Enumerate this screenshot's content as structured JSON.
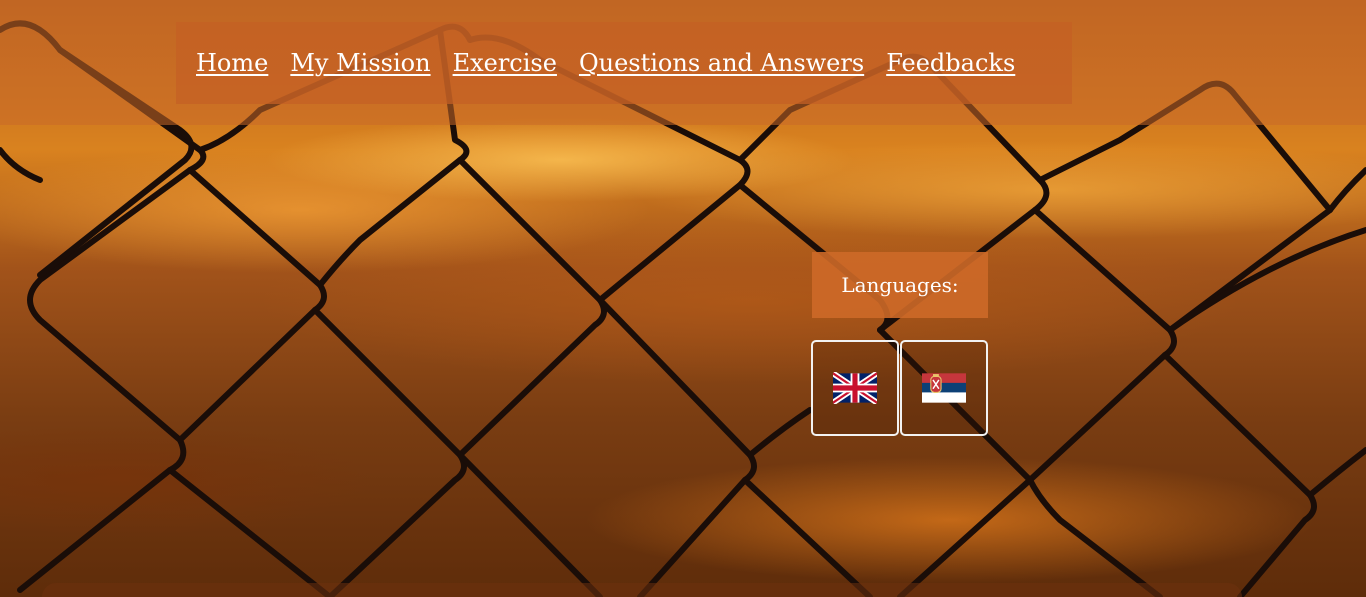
{
  "nav": {
    "items": [
      {
        "label": "Home"
      },
      {
        "label": "My Mission"
      },
      {
        "label": "Exercise"
      },
      {
        "label": "Questions and Answers"
      },
      {
        "label": "Feedbacks"
      }
    ]
  },
  "languages": {
    "label": "Languages:",
    "options": [
      {
        "icon": "uk-flag-icon"
      },
      {
        "icon": "serbia-flag-icon"
      }
    ]
  },
  "colors": {
    "nav_background": "#c46024",
    "language_label_background": "#cd6928",
    "link_text": "#ffffff"
  }
}
